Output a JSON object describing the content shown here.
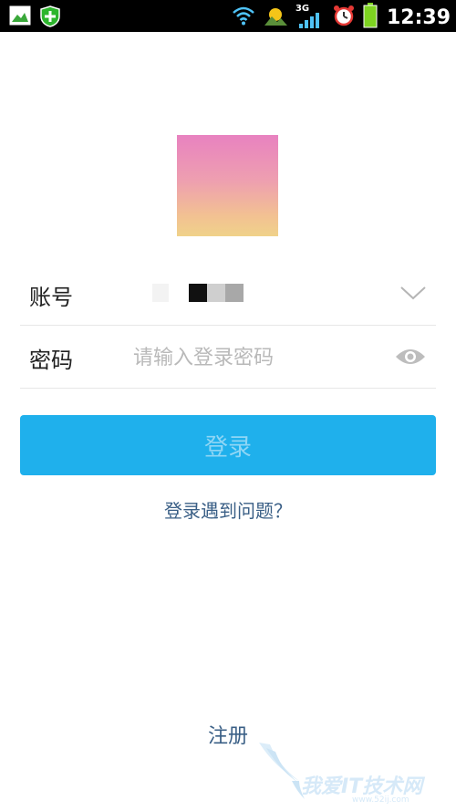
{
  "status_bar": {
    "time": "12:39",
    "network": "3G",
    "icons": [
      "gallery-icon",
      "security-shield-icon",
      "wifi-icon",
      "weather-icon",
      "signal-icon",
      "alarm-icon",
      "battery-icon"
    ],
    "colors": {
      "background": "#000000",
      "shield": "#2db52d",
      "battery": "#7ed321"
    }
  },
  "login_form": {
    "account": {
      "label": "账号",
      "value_masked": true
    },
    "password": {
      "label": "密码",
      "placeholder": "请输入登录密码",
      "value": ""
    },
    "login_button": "登录",
    "help_link": "登录遇到问题？"
  },
  "footer": {
    "register_link": "注册",
    "watermark_text": "我爱IT技术网",
    "watermark_url": "www.52ij.com"
  },
  "colors": {
    "accent": "#1fb0ec",
    "link": "#3a5f86",
    "divider": "#e6e6e6"
  }
}
